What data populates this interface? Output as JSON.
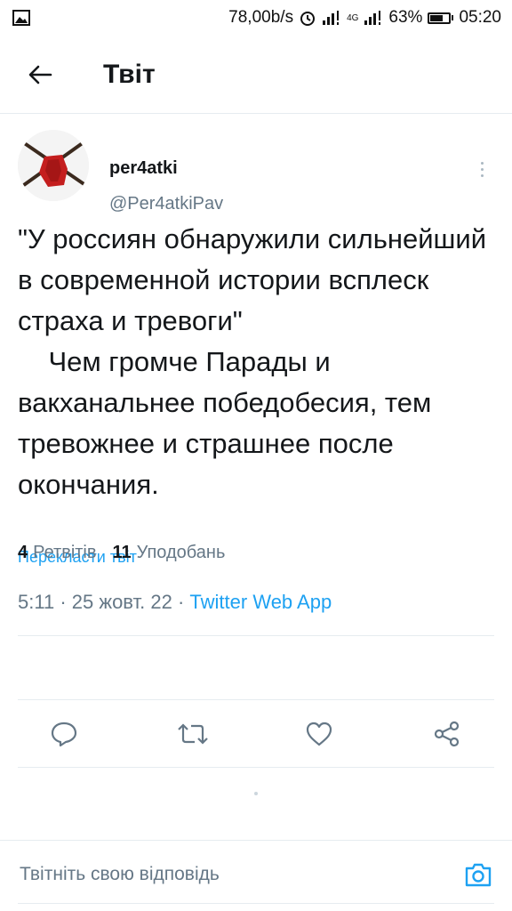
{
  "status_bar": {
    "speed": "78,00b/s",
    "network": "4G",
    "battery": "63%",
    "time": "05:20"
  },
  "header": {
    "title": "Твіт"
  },
  "tweet": {
    "author_name": "per4atki",
    "author_handle": "@Per4atkiPav",
    "text": "\"У россиян обнаружили сильнейший в современной истории всплеск страха и тревоги\"\n    Чем громче Парады и вакханальнее победобесия, тем тревожнее и страшнее после окончания.",
    "translate_label": "Перекласти твіт",
    "time": "5:11",
    "date": "25 жовт. 22",
    "app": "Twitter Web App",
    "separator": "·",
    "retweets_count": "4",
    "retweets_label": "Ретвітів",
    "likes_count": "11",
    "likes_label": "Уподобань"
  },
  "reply": {
    "placeholder": "Твітніть свою відповідь"
  },
  "colors": {
    "accent": "#1da1f2",
    "secondary_text": "#657786",
    "divider": "#e6ecf0"
  },
  "icons": {
    "back": "arrow-left-icon",
    "more": "more-vertical-icon",
    "reply": "comment-icon",
    "retweet": "retweet-icon",
    "like": "heart-icon",
    "share": "share-icon",
    "camera": "camera-icon"
  }
}
